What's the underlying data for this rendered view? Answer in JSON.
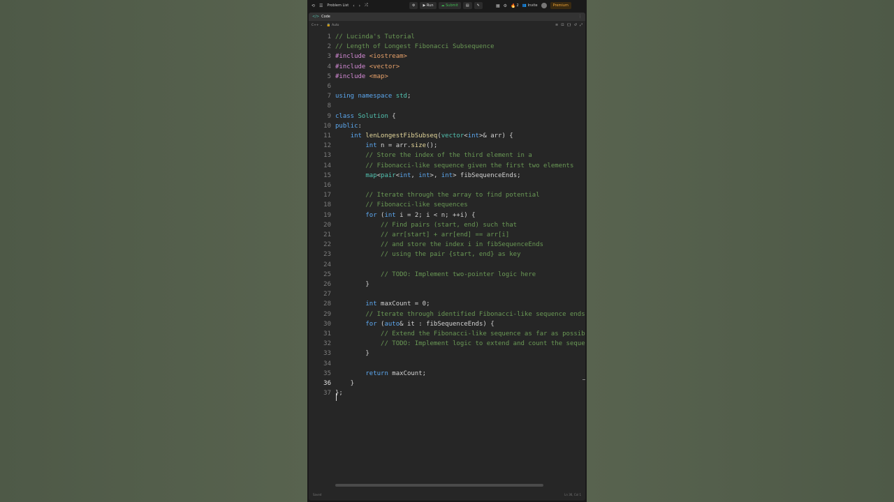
{
  "topbar": {
    "problems_list": "Problem List",
    "run": "Run",
    "submit": "Submit",
    "streak": "2",
    "invite": "Invite",
    "premium": "Premium"
  },
  "panel": {
    "tab_label": "Code",
    "language": "C++",
    "mode": "Auto"
  },
  "status": {
    "left": "Saved",
    "right": "Ln 36, Col 1"
  },
  "code": {
    "active_line": 36,
    "lines": [
      "// Lucinda's Tutorial",
      "// Length of Longest Fibonacci Subsequence",
      "#include <iostream>",
      "#include <vector>",
      "#include <map>",
      "",
      "using namespace std;",
      "",
      "class Solution {",
      "public:",
      "    int lenLongestFibSubseq(vector<int>& arr) {",
      "        int n = arr.size();",
      "        // Store the index of the third element in a",
      "        // Fibonacci-like sequence given the first two elements",
      "        map<pair<int, int>, int> fibSequenceEnds;",
      "",
      "        // Iterate through the array to find potential",
      "        // Fibonacci-like sequences",
      "        for (int i = 2; i < n; ++i) {",
      "            // Find pairs (start, end) such that",
      "            // arr[start] + arr[end] == arr[i]",
      "            // and store the index i in fibSequenceEnds",
      "            // using the pair {start, end} as key",
      "",
      "            // TODO: Implement two-pointer logic here",
      "        }",
      "",
      "        int maxCount = 0;",
      "        // Iterate through identified Fibonacci-like sequence ends",
      "        for (auto& it : fibSequenceEnds) {",
      "            // Extend the Fibonacci-like sequence as far as possible",
      "            // TODO: Implement logic to extend and count the sequence",
      "        }",
      "",
      "        return maxCount;",
      "    }",
      "};"
    ]
  }
}
